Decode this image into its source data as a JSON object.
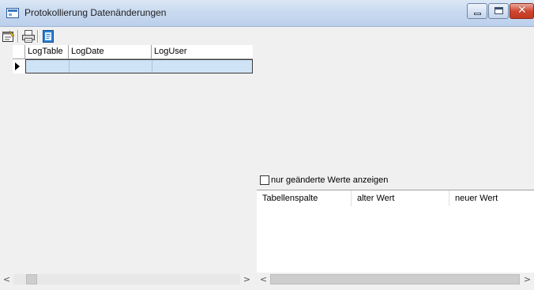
{
  "window": {
    "title": "Protokollierung Datenänderungen",
    "buttons": [
      "minimize",
      "maximize",
      "close"
    ]
  },
  "toolbar": {
    "items": [
      {
        "icon": "properties-icon"
      },
      {
        "icon": "print-icon"
      },
      {
        "icon": "export-icon"
      }
    ]
  },
  "left_grid": {
    "columns": [
      "LogTable",
      "LogDate",
      "LogUser"
    ],
    "rows": [
      [
        "",
        "",
        ""
      ]
    ],
    "selected_row": 0
  },
  "filter": {
    "checkbox_label": "nur geänderte Werte anzeigen",
    "checked": false
  },
  "right_grid": {
    "columns": [
      "Tabellenspalte",
      "alter Wert",
      "neuer Wert"
    ],
    "rows": []
  },
  "scrollbars": {
    "left_arrow": "<",
    "right_arrow": ">"
  },
  "colors": {
    "selected_row": "#cfe3f7",
    "close_button": "#c03a20",
    "titlebar": "#c9daf0"
  }
}
